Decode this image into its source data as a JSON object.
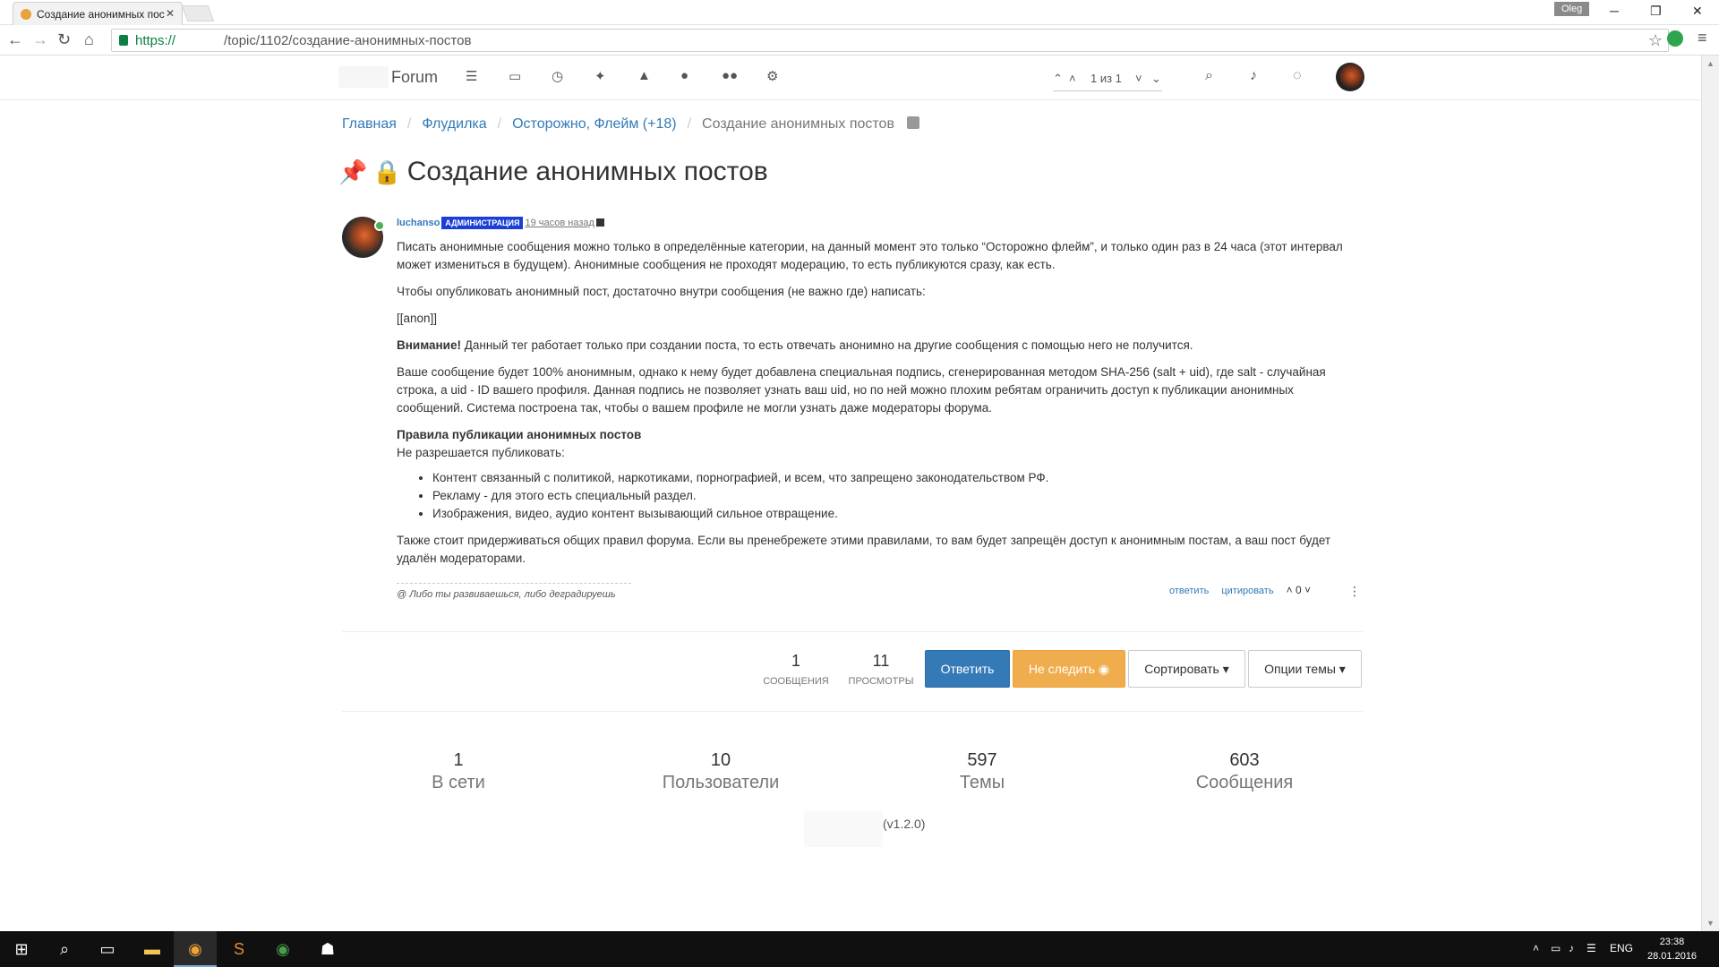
{
  "browser": {
    "tab_title": "Создание анонимных пос",
    "tab_close": "✕",
    "user_chip": "Oleg",
    "url_scheme": "https://",
    "url_path": "/topic/1102/создание-анонимных-постов"
  },
  "forum": {
    "brand": "Forum",
    "pager": {
      "label": "1 из 1"
    }
  },
  "breadcrumb": [
    {
      "label": "Главная"
    },
    {
      "label": "Флудилка"
    },
    {
      "label": "Осторожно, Флейм (+18)"
    },
    {
      "label": "Создание анонимных постов"
    }
  ],
  "topic": {
    "title": "Создание анонимных постов"
  },
  "post": {
    "author": "luchanso",
    "badge": "АДМИНИСТРАЦИЯ",
    "time": "19 часов назад",
    "p1": "Писать анонимные сообщения можно только в определённые категории, на данный момент это только “Осторожно флейм”, и только один раз в 24 часа (этот интервал может измениться в будущем). Анонимные сообщения не проходят модерацию, то есть публикуются сразу, как есть.",
    "p2": "Чтобы опубликовать анонимный пост, достаточно внутри сообщения (не важно где) написать:",
    "p3": "[[anon]]",
    "p4_bold": "Внимание!",
    "p4_rest": " Данный тег работает только при создании поста, то есть отвечать анонимно на другие сообщения с помощью него не получится.",
    "p5": "Ваше сообщение будет 100% анонимным, однако к нему будет добавлена специальная подпись, сгенерированная методом SHA-256 (salt + uid), где salt - случайная строка, а uid - ID вашего профиля. Данная подпись не позволяет узнать ваш uid, но по ней можно плохим ребятам ограничить доступ к публикации анонимных сообщений. Система построена так, чтобы о вашем профиле не могли узнать даже модераторы форума.",
    "rules_title": "Правила публикации анонимных постов",
    "rules_intro": "Не разрешается публиковать:",
    "rules": [
      "Контент связанный с политикой, наркотиками, порнографией, и всем, что запрещено законодательством РФ.",
      "Рекламу - для этого есть специальный раздел.",
      "Изображения, видео, аудио контент вызывающий сильное отвращение."
    ],
    "p6": "Также стоит придерживаться общих правил форума. Если вы пренебрежете этими правилами, то вам будет запрещён доступ к анонимным постам, а ваш пост будет удалён модераторами.",
    "signature": "@ Либо ты развиваешься, либо деградируешь",
    "reply": "ответить",
    "quote": "цитировать",
    "votes": "0"
  },
  "topic_stats": {
    "posts_num": "1",
    "posts_lbl": "СООБЩЕНИЯ",
    "views_num": "11",
    "views_lbl": "ПРОСМОТРЫ"
  },
  "buttons": {
    "reply": "Ответить",
    "unfollow": "Не следить",
    "sort": "Сортировать",
    "options": "Опции темы"
  },
  "footer_stats": [
    {
      "num": "1",
      "label": "В сети"
    },
    {
      "num": "10",
      "label": "Пользователи"
    },
    {
      "num": "597",
      "label": "Темы"
    },
    {
      "num": "603",
      "label": "Сообщения"
    }
  ],
  "version": "(v1.2.0)",
  "taskbar": {
    "lang": "ENG",
    "time": "23:38",
    "date": "28.01.2016"
  },
  "colors": {
    "link": "#337ab7",
    "primary": "#337ab7",
    "warning": "#f0ad4e",
    "badge": "#1a3fd6",
    "online": "#4caf50"
  },
  "icons": [
    "home-icon",
    "search-icon",
    "bell-icon",
    "chat-icon",
    "pin-icon",
    "lock-icon",
    "rss-icon"
  ]
}
